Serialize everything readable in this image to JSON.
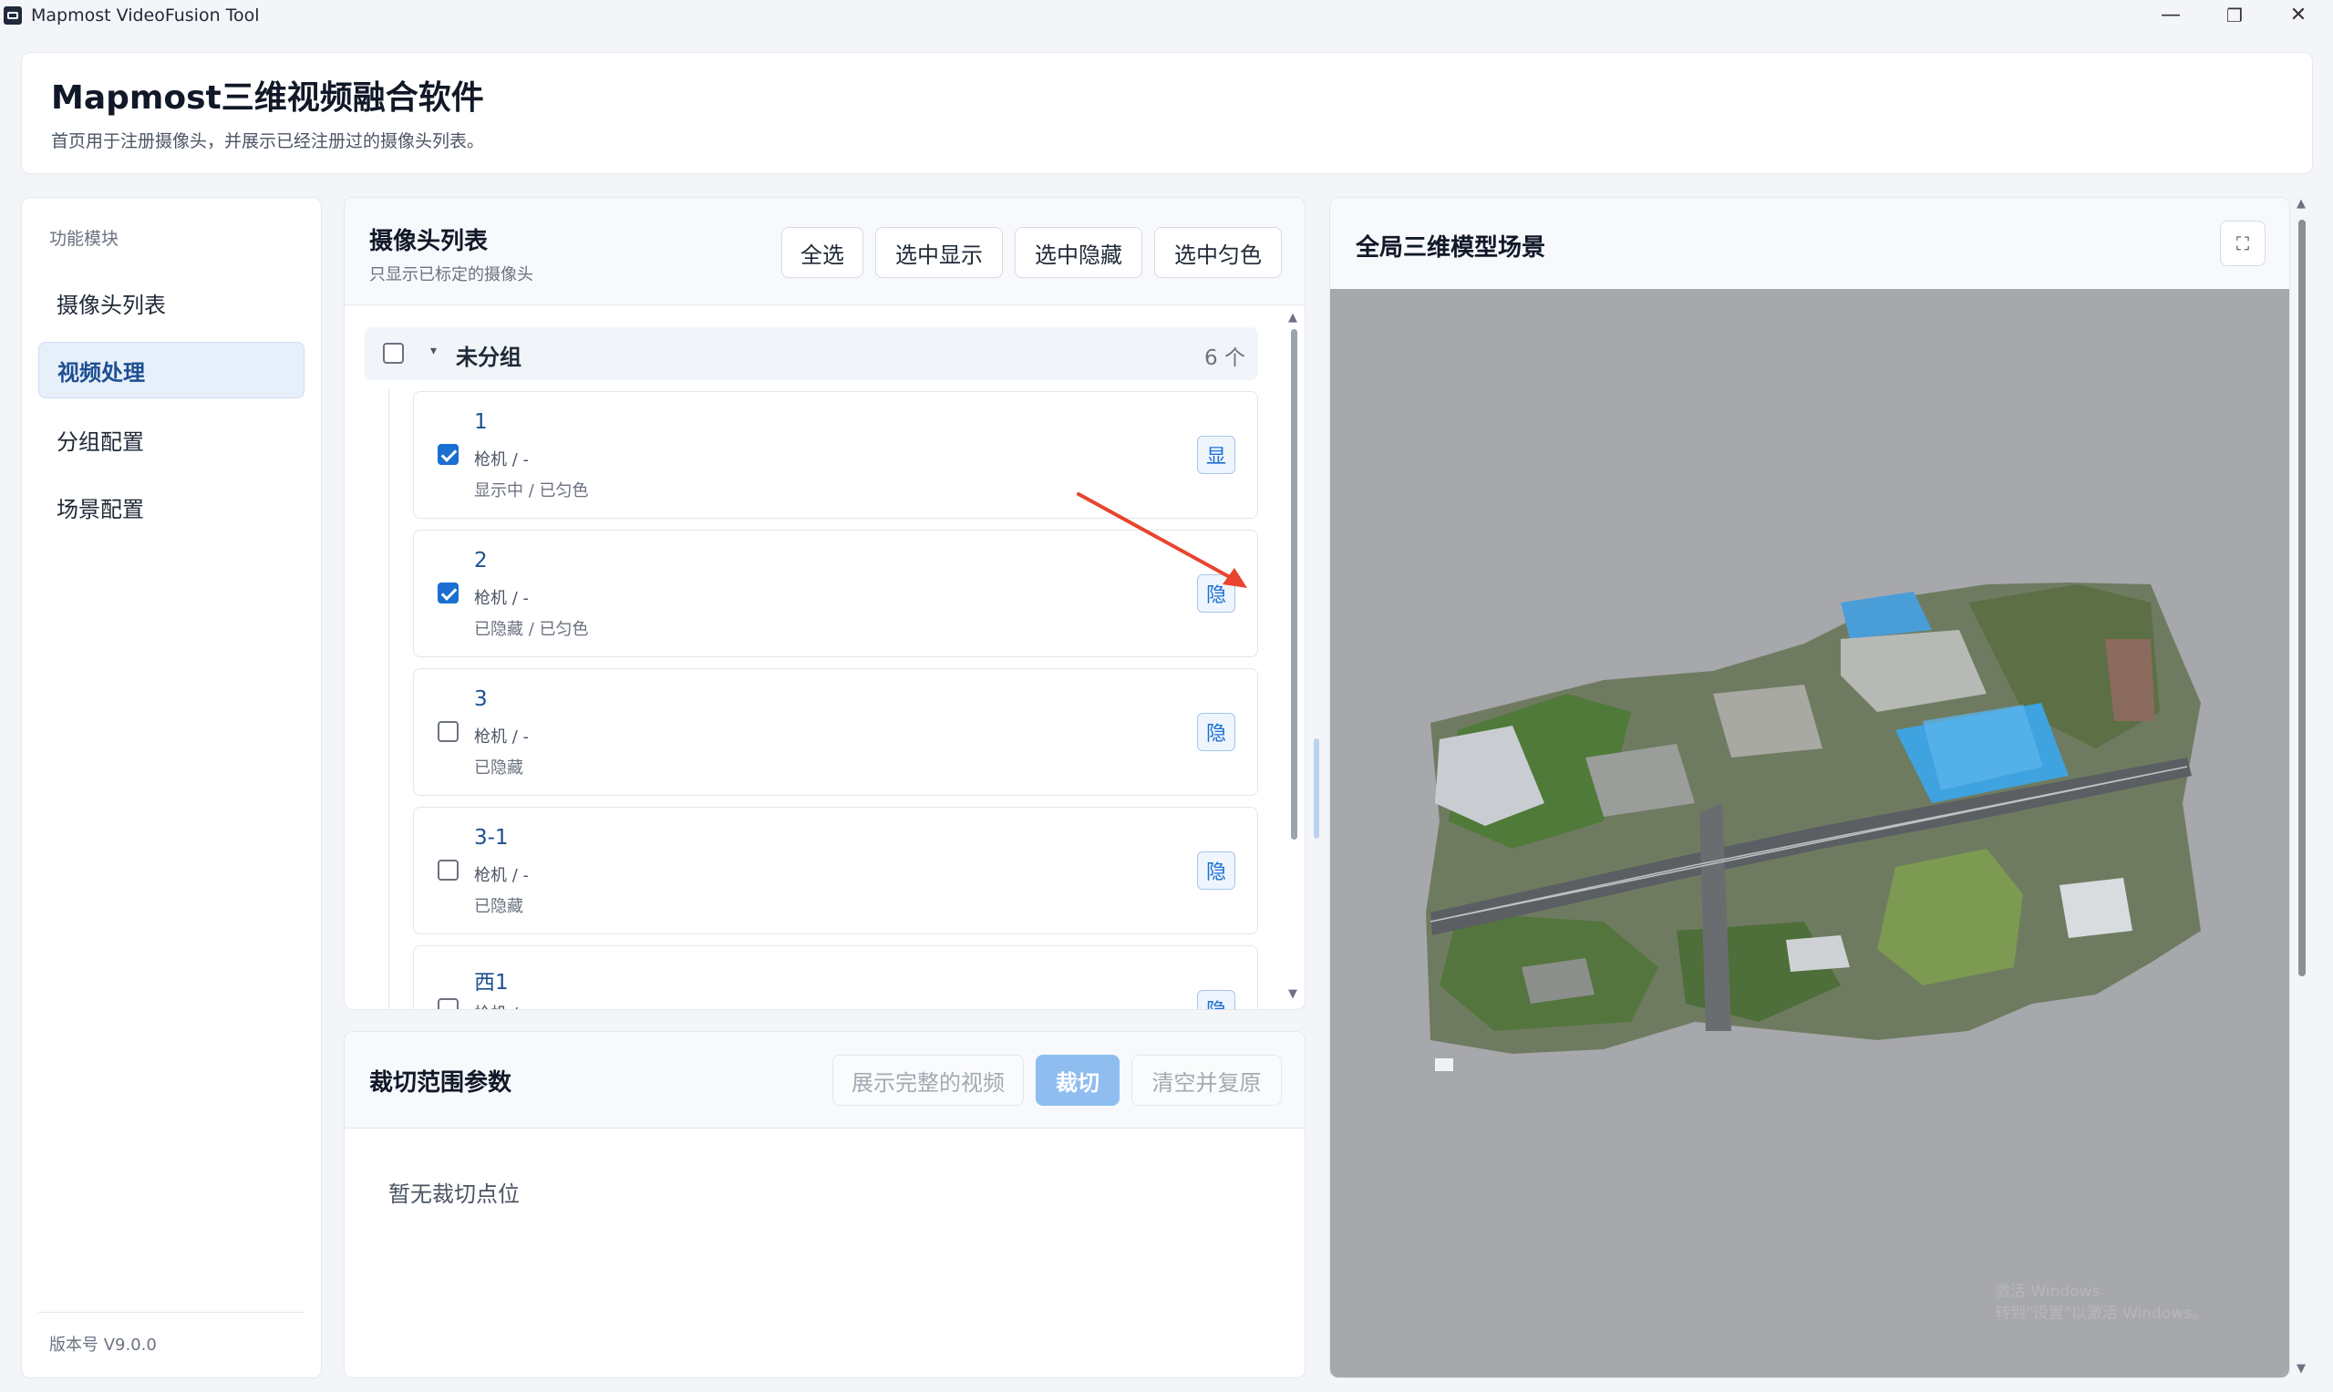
{
  "window": {
    "title": "Mapmost VideoFusion Tool",
    "minimize": "—",
    "restore": "❐",
    "close": "✕"
  },
  "header": {
    "title": "Mapmost三维视频融合软件",
    "subtitle": "首页用于注册摄像头，并展示已经注册过的摄像头列表。"
  },
  "sidebar": {
    "section_label": "功能模块",
    "items": [
      {
        "label": "摄像头列表",
        "active": false
      },
      {
        "label": "视频处理",
        "active": true
      },
      {
        "label": "分组配置",
        "active": false
      },
      {
        "label": "场景配置",
        "active": false
      }
    ],
    "version": "版本号 V9.0.0"
  },
  "camera_panel": {
    "title": "摄像头列表",
    "subtitle": "只显示已标定的摄像头",
    "buttons": {
      "select_all": "全选",
      "show_selected": "选中显示",
      "hide_selected": "选中隐藏",
      "even_color_selected": "选中匀色"
    },
    "group": {
      "name": "未分组",
      "count": "6 个",
      "caret": "▾"
    },
    "cameras": [
      {
        "name": "1",
        "type": "枪机 / -",
        "status": "显示中 / 已匀色",
        "checked": true,
        "toggle": "显"
      },
      {
        "name": "2",
        "type": "枪机 / -",
        "status": "已隐藏 / 已匀色",
        "checked": true,
        "toggle": "隐"
      },
      {
        "name": "3",
        "type": "枪机 / -",
        "status": "已隐藏",
        "checked": false,
        "toggle": "隐"
      },
      {
        "name": "3-1",
        "type": "枪机 / -",
        "status": "已隐藏",
        "checked": false,
        "toggle": "隐"
      },
      {
        "name": "西1",
        "type": "枪机 / -",
        "status": "",
        "checked": false,
        "toggle": "隐"
      }
    ]
  },
  "crop_panel": {
    "title": "裁切范围参数",
    "buttons": {
      "show_full_video": "展示完整的视频",
      "crop": "裁切",
      "clear_restore": "清空并复原"
    },
    "empty_text": "暂无裁切点位"
  },
  "scene_panel": {
    "title": "全局三维模型场景",
    "fullscreen_icon": "⛶",
    "watermark_line1": "激活 Windows",
    "watermark_line2": "转到\"设置\"以激活 Windows。"
  },
  "colors": {
    "accent": "#1a6fd1",
    "active_nav_bg": "#e6effa",
    "viewport_bg": "#a7a8ab",
    "annotation_arrow": "#e8442e"
  }
}
